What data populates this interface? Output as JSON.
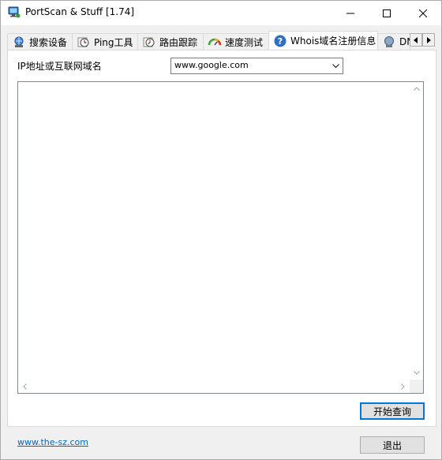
{
  "window": {
    "title": "PortScan & Stuff [1.74]",
    "app_icon": "monitor-network-icon",
    "controls": [
      "minimize-icon",
      "maximize-icon",
      "close-icon"
    ]
  },
  "tabs": [
    {
      "label": "搜索设备",
      "icon": "network-search-icon",
      "active": false
    },
    {
      "label": "Ping工具",
      "icon": "ping-clock-icon",
      "active": false
    },
    {
      "label": "路由跟踪",
      "icon": "traceroute-clock-icon",
      "active": false
    },
    {
      "label": "速度测试",
      "icon": "speedometer-icon",
      "active": false
    },
    {
      "label": "Whois域名注册信息",
      "icon": "question-icon",
      "active": true
    },
    {
      "label": "DN",
      "icon": "dns-monitor-icon",
      "active": false
    }
  ],
  "whois": {
    "ip_label": "IP地址或互联网域名",
    "domain_value": "www.google.com",
    "result_text": "",
    "query_button": "开始查询"
  },
  "footer": {
    "link": "www.the-sz.com",
    "exit_button": "退出"
  },
  "colors": {
    "accent": "#0078d7",
    "link": "#0066cc",
    "window_bg": "#f0f0f0"
  }
}
